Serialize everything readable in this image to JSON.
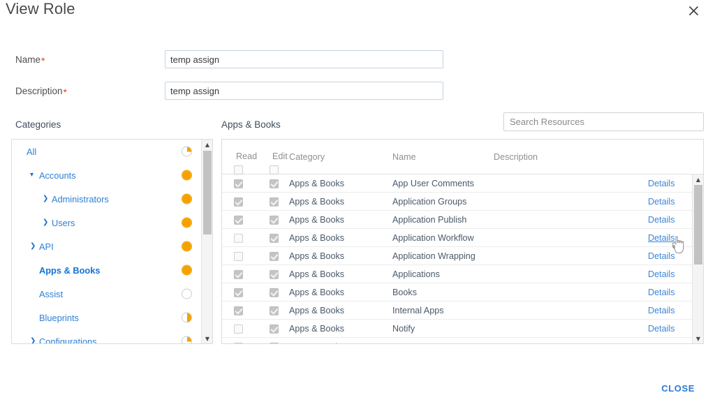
{
  "dialog": {
    "title": "View Role",
    "close_icon": "close-icon",
    "footer_close_label": "CLOSE"
  },
  "form": {
    "name": {
      "label": "Name",
      "required_marker": "*",
      "value": "temp assign",
      "placeholder": ""
    },
    "description": {
      "label": "Description",
      "required_marker": "*",
      "value": "temp assign",
      "placeholder": ""
    }
  },
  "search": {
    "placeholder": "Search Resources",
    "value": ""
  },
  "categories_section": {
    "heading": "Categories",
    "items": [
      {
        "label": "All",
        "indent": 0,
        "caret": "",
        "selected": false,
        "indicator": "quarter"
      },
      {
        "label": "Accounts",
        "indent": 1,
        "caret": "▾",
        "selected": false,
        "indicator": "full"
      },
      {
        "label": "Administrators",
        "indent": 2,
        "caret": "❯",
        "selected": false,
        "indicator": "full"
      },
      {
        "label": "Users",
        "indent": 2,
        "caret": "❯",
        "selected": false,
        "indicator": "full"
      },
      {
        "label": "API",
        "indent": 1,
        "caret": "❯",
        "selected": false,
        "indicator": "full"
      },
      {
        "label": "Apps & Books",
        "indent": 1,
        "caret": "",
        "selected": true,
        "indicator": "full"
      },
      {
        "label": "Assist",
        "indent": 1,
        "caret": "",
        "selected": false,
        "indicator": "empty"
      },
      {
        "label": "Blueprints",
        "indent": 1,
        "caret": "",
        "selected": false,
        "indicator": "half"
      },
      {
        "label": "Configurations",
        "indent": 1,
        "caret": "❯",
        "selected": false,
        "indicator": "quarter"
      }
    ]
  },
  "resources_section": {
    "heading": "Apps & Books",
    "columns": {
      "read": "Read",
      "edit": "Edit",
      "category": "Category",
      "name": "Name",
      "description": "Description"
    },
    "header_checkboxes": {
      "read": false,
      "edit": false
    },
    "details_label": "Details",
    "rows": [
      {
        "read": true,
        "edit": true,
        "category": "Apps & Books",
        "name": "App User Comments",
        "description": "",
        "details": "Details",
        "hovered": false
      },
      {
        "read": true,
        "edit": true,
        "category": "Apps & Books",
        "name": "Application Groups",
        "description": "",
        "details": "Details",
        "hovered": false
      },
      {
        "read": true,
        "edit": true,
        "category": "Apps & Books",
        "name": "Application Publish",
        "description": "",
        "details": "Details",
        "hovered": false
      },
      {
        "read": false,
        "edit": true,
        "category": "Apps & Books",
        "name": "Application Workflow",
        "description": "",
        "details": "Details",
        "hovered": true
      },
      {
        "read": false,
        "edit": true,
        "category": "Apps & Books",
        "name": "Application Wrapping",
        "description": "",
        "details": "Details",
        "hovered": false
      },
      {
        "read": true,
        "edit": true,
        "category": "Apps & Books",
        "name": "Applications",
        "description": "",
        "details": "Details",
        "hovered": false
      },
      {
        "read": true,
        "edit": true,
        "category": "Apps & Books",
        "name": "Books",
        "description": "",
        "details": "Details",
        "hovered": false
      },
      {
        "read": true,
        "edit": true,
        "category": "Apps & Books",
        "name": "Internal Apps",
        "description": "",
        "details": "Details",
        "hovered": false
      },
      {
        "read": false,
        "edit": true,
        "category": "Apps & Books",
        "name": "Notify",
        "description": "",
        "details": "Details",
        "hovered": false
      },
      {
        "read": false,
        "edit": true,
        "category": "Apps & Books",
        "name": "",
        "description": "",
        "details": "",
        "hovered": false
      }
    ]
  },
  "colors": {
    "accent_link": "#2a7bd4",
    "indicator_orange": "#f5a200",
    "required_red": "#cf4520",
    "text_dark": "#4a4a4a",
    "border": "#d8dde2"
  },
  "scrollbars": {
    "categories": {
      "up_arrow": "▲",
      "down_arrow": "▼"
    },
    "resources": {
      "up_arrow": "▲",
      "down_arrow": "▼"
    }
  }
}
